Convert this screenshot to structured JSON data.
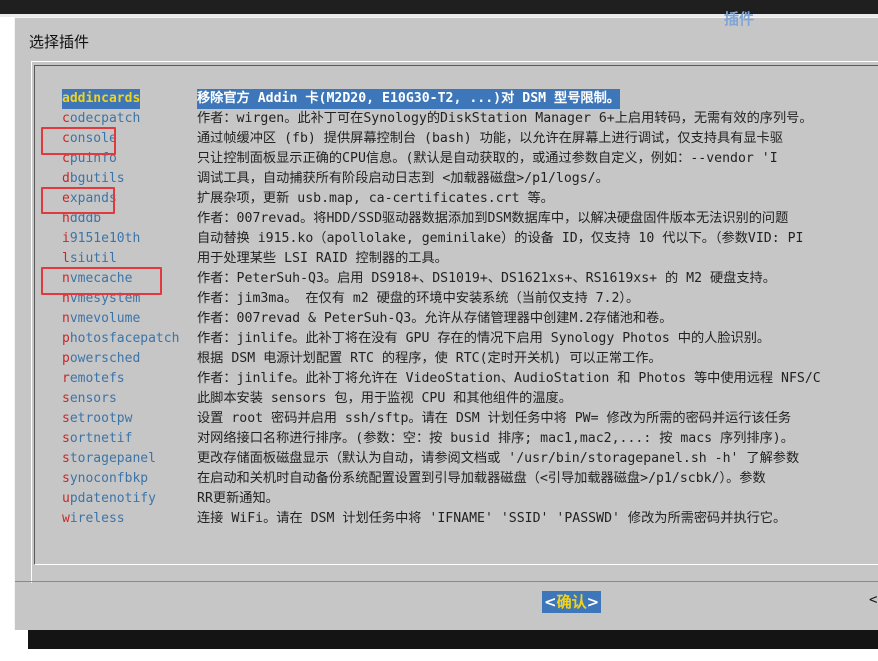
{
  "window": {
    "background_title": "插件"
  },
  "dialog": {
    "title": "选择插件",
    "ok_button": {
      "left": "<",
      "label": "确认",
      "right": ">"
    },
    "scroll_arrow": "<"
  },
  "addons": [
    {
      "hot": "a",
      "rest": "ddincards",
      "desc": "移除官方 Addin 卡(M2D20, E10G30-T2, ...)对 DSM 型号限制。",
      "selected": true
    },
    {
      "hot": "c",
      "rest": "odecpatch",
      "desc": "作者：wirgen。此补丁可在Synology的DiskStation Manager 6+上启用转码，无需有效的序列号。"
    },
    {
      "hot": "c",
      "rest": "onsole",
      "desc": "通过帧缓冲区 (fb) 提供屏幕控制台 (bash) 功能，以允许在屏幕上进行调试，仅支持具有显卡驱"
    },
    {
      "hot": "c",
      "rest": "puinfo",
      "desc": "只让控制面板显示正确的CPU信息。(默认是自动获取的，或通过参数自定义，例如：--vendor 'I"
    },
    {
      "hot": "d",
      "rest": "bgutils",
      "desc": "调试工具，自动捕获所有阶段启动日志到 <加载器磁盘>/p1/logs/。"
    },
    {
      "hot": "e",
      "rest": "xpands",
      "desc": "扩展杂项，更新 usb.map, ca-certificates.crt 等。"
    },
    {
      "hot": "h",
      "rest": "dddb",
      "desc": "作者：007revad。将HDD/SSD驱动器数据添加到DSM数据库中，以解决硬盘固件版本无法识别的问题"
    },
    {
      "hot": "i",
      "rest": "9151e10th",
      "desc": "自动替换 i915.ko（apollolake, geminilake）的设备 ID，仅支持 10 代以下。（参数VID: PI"
    },
    {
      "hot": "l",
      "rest": "siutil",
      "desc": "用于处理某些 LSI RAID 控制器的工具。"
    },
    {
      "hot": "n",
      "rest": "vmecache",
      "desc": "作者：PeterSuh-Q3。启用 DS918+、DS1019+、DS1621xs+、RS1619xs+ 的 M2 硬盘支持。"
    },
    {
      "hot": "n",
      "rest": "vmesystem",
      "desc": "作者：jim3ma。 在仅有 m2 硬盘的环境中安装系统（当前仅支持 7.2）。"
    },
    {
      "hot": "n",
      "rest": "vmevolume",
      "desc": "作者：007revad & PeterSuh-Q3。允许从存储管理器中创建M.2存储池和卷。"
    },
    {
      "hot": "p",
      "rest": "hotosfacepatch",
      "desc": "作者：jinlife。此补丁将在没有 GPU 存在的情况下启用 Synology Photos 中的人脸识别。"
    },
    {
      "hot": "p",
      "rest": "owersched",
      "desc": "根据 DSM 电源计划配置 RTC 的程序，使 RTC(定时开关机) 可以正常工作。"
    },
    {
      "hot": "r",
      "rest": "emotefs",
      "desc": "作者：jinlife。此补丁将允许在 VideoStation、AudioStation 和 Photos 等中使用远程 NFS/C"
    },
    {
      "hot": "s",
      "rest": "ensors",
      "desc": "此脚本安装 sensors 包，用于监视 CPU 和其他组件的温度。"
    },
    {
      "hot": "s",
      "rest": "etrootpw",
      "desc": "设置 root 密码并启用 ssh/sftp。请在 DSM 计划任务中将 PW= 修改为所需的密码并运行该任务"
    },
    {
      "hot": "s",
      "rest": "ortnetif",
      "desc": "对网络接口名称进行排序。(参数：空：按 busid 排序; mac1,mac2,...: 按 macs 序列排序)。"
    },
    {
      "hot": "s",
      "rest": "toragepanel",
      "desc": "更改存储面板磁盘显示（默认为自动，请参阅文档或 '/usr/bin/storagepanel.sh -h' 了解参数"
    },
    {
      "hot": "s",
      "rest": "ynoconfbkp",
      "desc": "在启动和关机时自动备份系统配置设置到引导加载器磁盘（<引导加载器磁盘>/p1/scbk/）。参数"
    },
    {
      "hot": "u",
      "rest": "pdatenotify",
      "desc": "RR更新通知。"
    },
    {
      "hot": "w",
      "rest": "ireless",
      "desc": "连接 WiFi。请在 DSM 计划任务中将 'IFNAME' 'SSID' 'PASSWD' 修改为所需密码并执行它。"
    }
  ]
}
